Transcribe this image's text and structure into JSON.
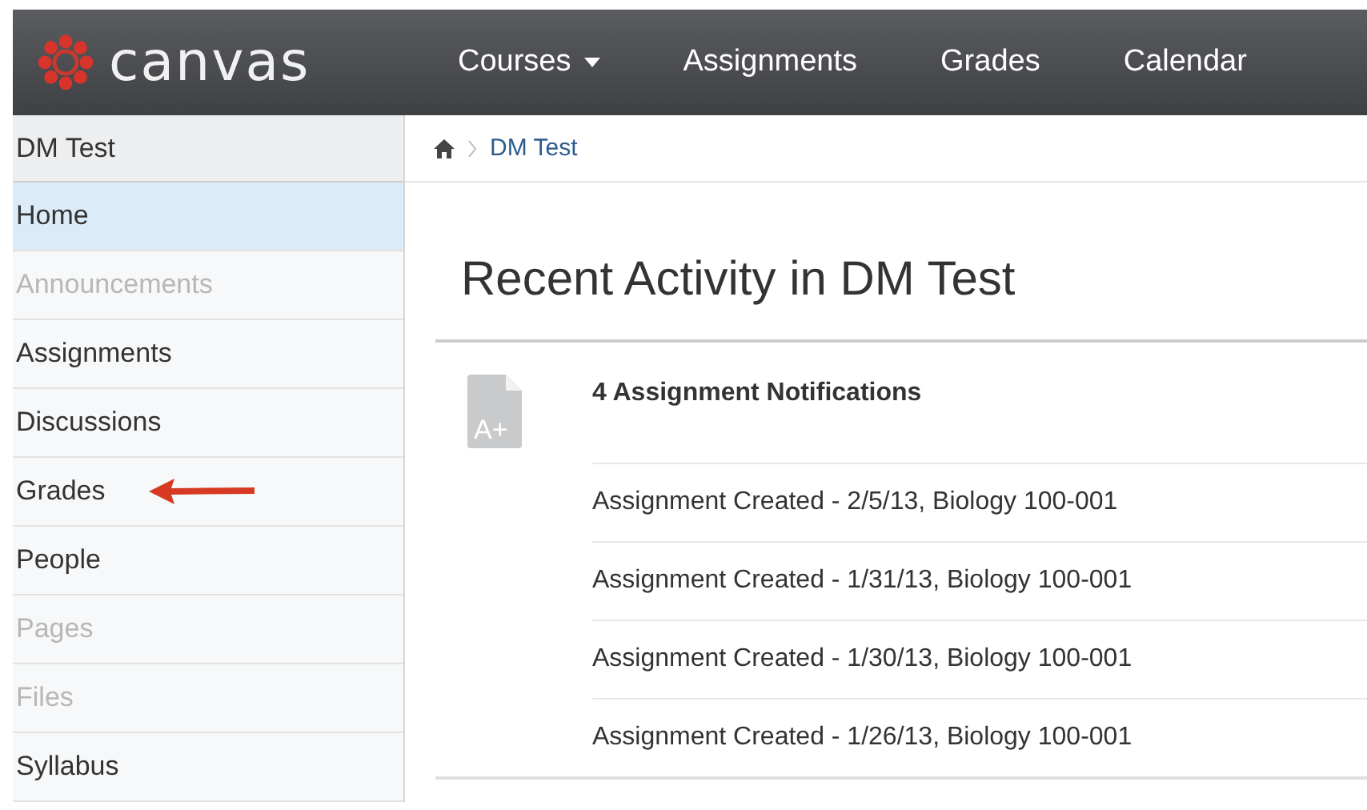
{
  "header": {
    "logo_text": "canvas",
    "nav": [
      {
        "label": "Courses",
        "dropdown": true
      },
      {
        "label": "Assignments",
        "dropdown": false
      },
      {
        "label": "Grades",
        "dropdown": false
      },
      {
        "label": "Calendar",
        "dropdown": false
      }
    ]
  },
  "sidebar": {
    "title": "DM Test",
    "items": [
      {
        "label": "Home",
        "selected": true,
        "disabled": false
      },
      {
        "label": "Announcements",
        "selected": false,
        "disabled": true
      },
      {
        "label": "Assignments",
        "selected": false,
        "disabled": false
      },
      {
        "label": "Discussions",
        "selected": false,
        "disabled": false
      },
      {
        "label": "Grades",
        "selected": false,
        "disabled": false
      },
      {
        "label": "People",
        "selected": false,
        "disabled": false
      },
      {
        "label": "Pages",
        "selected": false,
        "disabled": true
      },
      {
        "label": "Files",
        "selected": false,
        "disabled": true
      },
      {
        "label": "Syllabus",
        "selected": false,
        "disabled": false
      }
    ]
  },
  "breadcrumb": {
    "items": [
      "DM Test"
    ]
  },
  "heading": "Recent Activity in DM Test",
  "activity": {
    "icon_text": "A+",
    "title": "4 Assignment Notifications",
    "items": [
      "Assignment Created - 2/5/13, Biology 100-001",
      "Assignment Created - 1/31/13, Biology 100-001",
      "Assignment Created - 1/30/13, Biology 100-001",
      "Assignment Created - 1/26/13, Biology 100-001"
    ]
  }
}
